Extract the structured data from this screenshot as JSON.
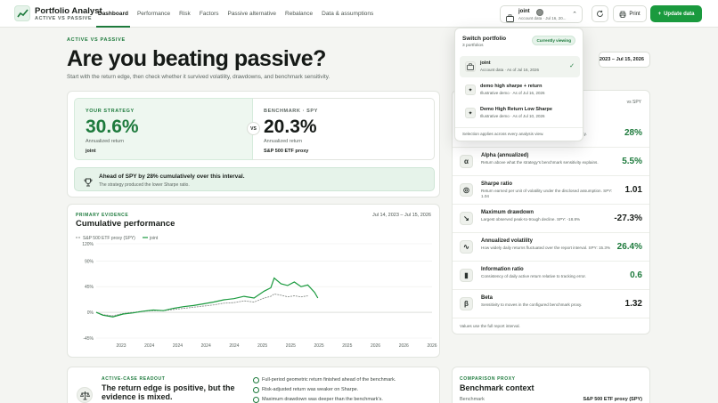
{
  "brand": {
    "title": "Portfolio Analyst",
    "subtitle": "ACTIVE VS PASSIVE"
  },
  "nav": [
    "Dashboard",
    "Performance",
    "Risk",
    "Factors",
    "Passive alternative",
    "Rebalance",
    "Data & assumptions"
  ],
  "portfolio_button": {
    "name": "joint",
    "sub": "Account data · Jul 16, 20..."
  },
  "toolbar": {
    "print_label": "Print",
    "update_label": "Update data"
  },
  "hero": {
    "eyebrow": "ACTIVE VS PASSIVE",
    "title": "Are you beating passive?",
    "subtitle": "Start with the return edge, then check whether it survived volatility, drawdowns, and benchmark sensitivity.",
    "date_range": "Jul 14, 2023 – Jul 15, 2026"
  },
  "comparison": {
    "strategy": {
      "label": "YOUR STRATEGY",
      "value": "30.6%",
      "caption": "Annualized return",
      "name": "joint"
    },
    "vs": "VS",
    "benchmark": {
      "label": "BENCHMARK · SPY",
      "value": "20.3%",
      "caption": "Annualized return",
      "name": "S&P 500 ETF proxy"
    },
    "ahead_title": "Ahead of SPY by 28% cumulatively over this interval.",
    "ahead_sub": "The strategy produced the lower Sharpe ratio."
  },
  "chart": {
    "eyebrow": "PRIMARY EVIDENCE",
    "title": "Cumulative performance",
    "range": "Jul 14, 2023 – Jul 15, 2026",
    "legend": [
      "S&P 500 ETF proxy (SPY)",
      "joint"
    ]
  },
  "chart_data": {
    "type": "line",
    "title": "Cumulative performance",
    "y_ticks": [
      "120%",
      "90%",
      "45%",
      "0%",
      "-45%"
    ],
    "x_ticks": [
      "2023",
      "2024",
      "2024",
      "2024",
      "2024",
      "2025",
      "2025",
      "2025",
      "2025",
      "2026",
      "2026",
      "2026"
    ],
    "ylim": [
      -45,
      120
    ],
    "x_range": [
      0,
      1
    ],
    "series": [
      {
        "name": "joint",
        "color": "#1a9a3e",
        "points": [
          [
            0.0,
            0
          ],
          [
            0.02,
            -5
          ],
          [
            0.05,
            -8
          ],
          [
            0.08,
            -3
          ],
          [
            0.11,
            -1
          ],
          [
            0.14,
            2
          ],
          [
            0.17,
            4
          ],
          [
            0.2,
            3
          ],
          [
            0.23,
            7
          ],
          [
            0.26,
            10
          ],
          [
            0.29,
            12
          ],
          [
            0.32,
            15
          ],
          [
            0.35,
            18
          ],
          [
            0.38,
            22
          ],
          [
            0.41,
            24
          ],
          [
            0.44,
            28
          ],
          [
            0.47,
            25
          ],
          [
            0.5,
            37
          ],
          [
            0.52,
            43
          ],
          [
            0.53,
            60
          ],
          [
            0.55,
            50
          ],
          [
            0.57,
            47
          ],
          [
            0.59,
            53
          ],
          [
            0.61,
            45
          ],
          [
            0.63,
            48
          ],
          [
            0.65,
            35
          ],
          [
            0.66,
            25
          ]
        ]
      },
      {
        "name": "S&P 500 ETF proxy (SPY)",
        "color": "#8a8f8b",
        "points": [
          [
            0.0,
            0
          ],
          [
            0.02,
            -4
          ],
          [
            0.05,
            -6
          ],
          [
            0.08,
            -2
          ],
          [
            0.11,
            0
          ],
          [
            0.14,
            2
          ],
          [
            0.17,
            3
          ],
          [
            0.2,
            3
          ],
          [
            0.23,
            5
          ],
          [
            0.26,
            7
          ],
          [
            0.29,
            9
          ],
          [
            0.32,
            11
          ],
          [
            0.35,
            13
          ],
          [
            0.38,
            16
          ],
          [
            0.41,
            17
          ],
          [
            0.44,
            20
          ],
          [
            0.47,
            18
          ],
          [
            0.5,
            25
          ],
          [
            0.52,
            28
          ],
          [
            0.53,
            32
          ],
          [
            0.55,
            30
          ],
          [
            0.57,
            27
          ],
          [
            0.59,
            29
          ],
          [
            0.61,
            27
          ],
          [
            0.63,
            29
          ]
        ]
      }
    ]
  },
  "metrics": {
    "head": "vs SPY",
    "first_value": "28%",
    "first_desc": "Cumulative return difference against the benchmark proxy.",
    "rows": [
      {
        "icon": "α",
        "name": "Alpha (annualized)",
        "desc": "Return above what the strategy's benchmark sensitivity explains.",
        "value": "5.5%",
        "green": true
      },
      {
        "icon": "◎",
        "name": "Sharpe ratio",
        "desc": "Return earned per unit of volatility under the disclosed assumption. SPY: 1.04",
        "value": "1.01",
        "green": false
      },
      {
        "icon": "↘",
        "name": "Maximum drawdown",
        "desc": "Largest observed peak-to-trough decline. SPY: -18.8%",
        "value": "-27.3%",
        "green": false
      },
      {
        "icon": "∿",
        "name": "Annualized volatility",
        "desc": "How widely daily returns fluctuated over the report interval. SPY: 15.3%",
        "value": "26.4%",
        "green": true
      },
      {
        "icon": "▮",
        "name": "Information ratio",
        "desc": "Consistency of daily active return relative to tracking error.",
        "value": "0.6",
        "green": true
      },
      {
        "icon": "β",
        "name": "Beta",
        "desc": "Sensitivity to moves in the configured benchmark proxy.",
        "value": "1.32",
        "green": false
      }
    ],
    "foot": "Values use the full report interval."
  },
  "readout": {
    "eyebrow": "ACTIVE-CASE READOUT",
    "title": "The return edge is positive, but the evidence is mixed.",
    "items": [
      "Full-period geometric return finished ahead of the benchmark.",
      "Risk-adjusted return was weaker on Sharpe.",
      "Maximum drawdown was deeper than the benchmark's."
    ]
  },
  "context": {
    "eyebrow": "COMPARISON PROXY",
    "title": "Benchmark context",
    "key": "Benchmark",
    "value": "S&P 500 ETF proxy (SPY)"
  },
  "dropdown": {
    "title": "Switch portfolio",
    "count": "3 portfolios",
    "badge": "Currently viewing",
    "items": [
      {
        "name": "joint",
        "sub": "Account data · As of Jul 16, 2026",
        "selected": true
      },
      {
        "name": "demo high sharpe + return",
        "sub": "Illustrative demo · As of Jul 16, 2026",
        "selected": false
      },
      {
        "name": "Demo High Return Low Sharpe",
        "sub": "Illustrative demo · As of Jul 10, 2026",
        "selected": false
      }
    ],
    "footer": "Selection applies across every analysis view."
  }
}
